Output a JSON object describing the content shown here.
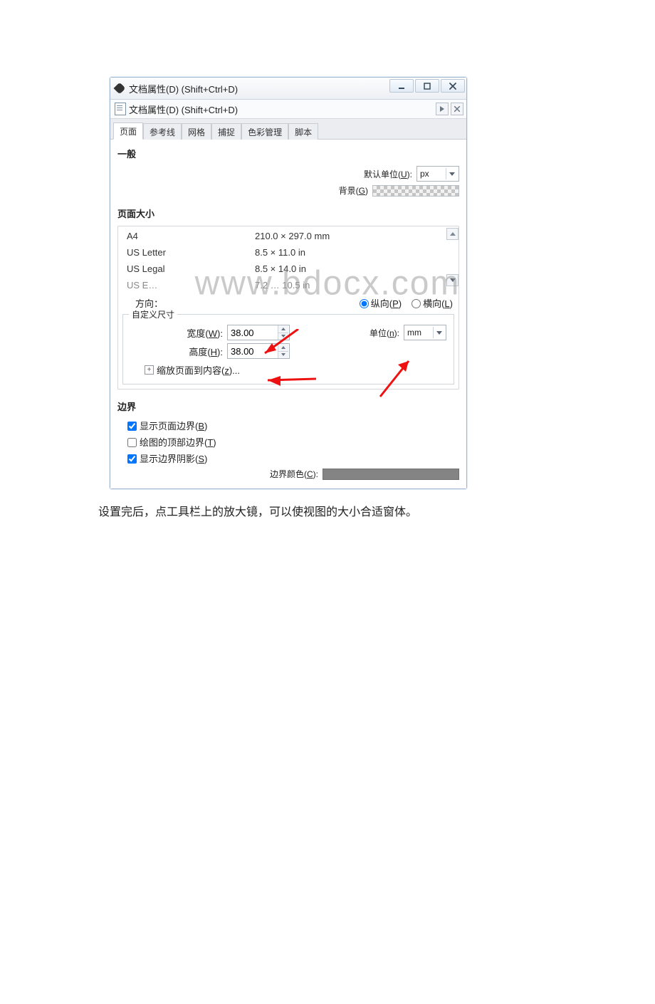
{
  "outer_window": {
    "title": "文档属性(D) (Shift+Ctrl+D)"
  },
  "inner_panel": {
    "title": "文档属性(D) (Shift+Ctrl+D)"
  },
  "tabs": [
    {
      "label": "页面"
    },
    {
      "label": "参考线"
    },
    {
      "label": "网格"
    },
    {
      "label": "捕捉"
    },
    {
      "label": "色彩管理"
    },
    {
      "label": "脚本"
    }
  ],
  "general": {
    "heading": "一般",
    "default_unit_label": "默认单位(U):",
    "default_unit_value": "px",
    "background_label": "背景(G)"
  },
  "page_size": {
    "heading": "页面大小",
    "items": [
      {
        "name": "A4",
        "dim": "210.0 × 297.0 mm"
      },
      {
        "name": "US Letter",
        "dim": "8.5 × 11.0 in"
      },
      {
        "name": "US Legal",
        "dim": "8.5 × 14.0 in"
      },
      {
        "name": "US E…",
        "dim": "7.2 … 10.5 in"
      }
    ],
    "orientation_label": "方向：",
    "portrait_label": "纵向(P)",
    "landscape_label": "横向(L)",
    "custom_heading": "自定义尺寸",
    "width_label": "宽度(W):",
    "width_value": "38.00",
    "height_label": "高度(H):",
    "height_value": "38.00",
    "unit_label": "单位(n):",
    "unit_value": "mm",
    "fit_label": "缩放页面到内容(z)..."
  },
  "border": {
    "heading": "边界",
    "show_border_label": "显示页面边界(B)",
    "top_border_label": "绘图的顶部边界(T)",
    "show_shadow_label": "显示边界阴影(S)",
    "border_color_label": "边界颜色(C):"
  },
  "watermark": "www.bdocx.com",
  "caption_text": "设置完后，点工具栏上的放大镜，可以使视图的大小合适窗体。"
}
